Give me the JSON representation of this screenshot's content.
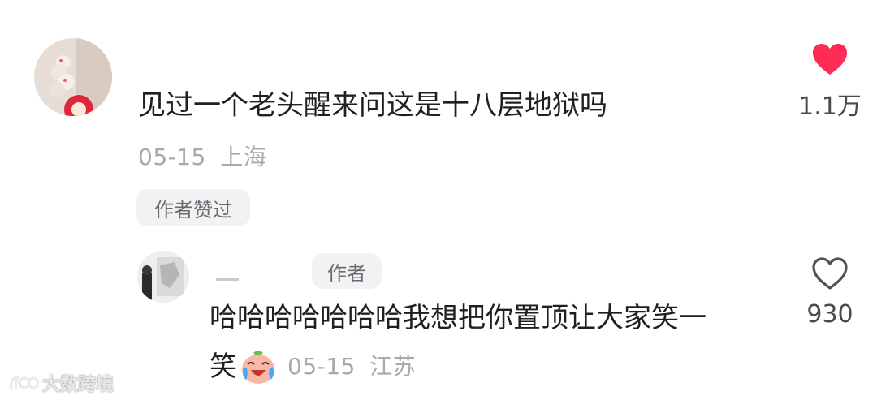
{
  "comment": {
    "text": "见过一个老头醒来问这是十八层地狱吗",
    "date": "05-15",
    "location": "上海",
    "author_liked_badge": "作者赞过",
    "like_count": "1.1万",
    "liked": true
  },
  "reply": {
    "author_badge": "作者",
    "text_line1": "哈哈哈哈哈哈哈我想把你置顶让大家笑一",
    "text_line2": "笑",
    "date": "05-15",
    "location": "江苏",
    "like_count": "930",
    "liked": false,
    "emoji": "crying-laughing-face"
  },
  "watermark": {
    "text": "大数跨境"
  },
  "colors": {
    "heart_filled": "#fe2c55",
    "heart_outline": "#50515a",
    "meta_gray": "#a8a9ad"
  }
}
